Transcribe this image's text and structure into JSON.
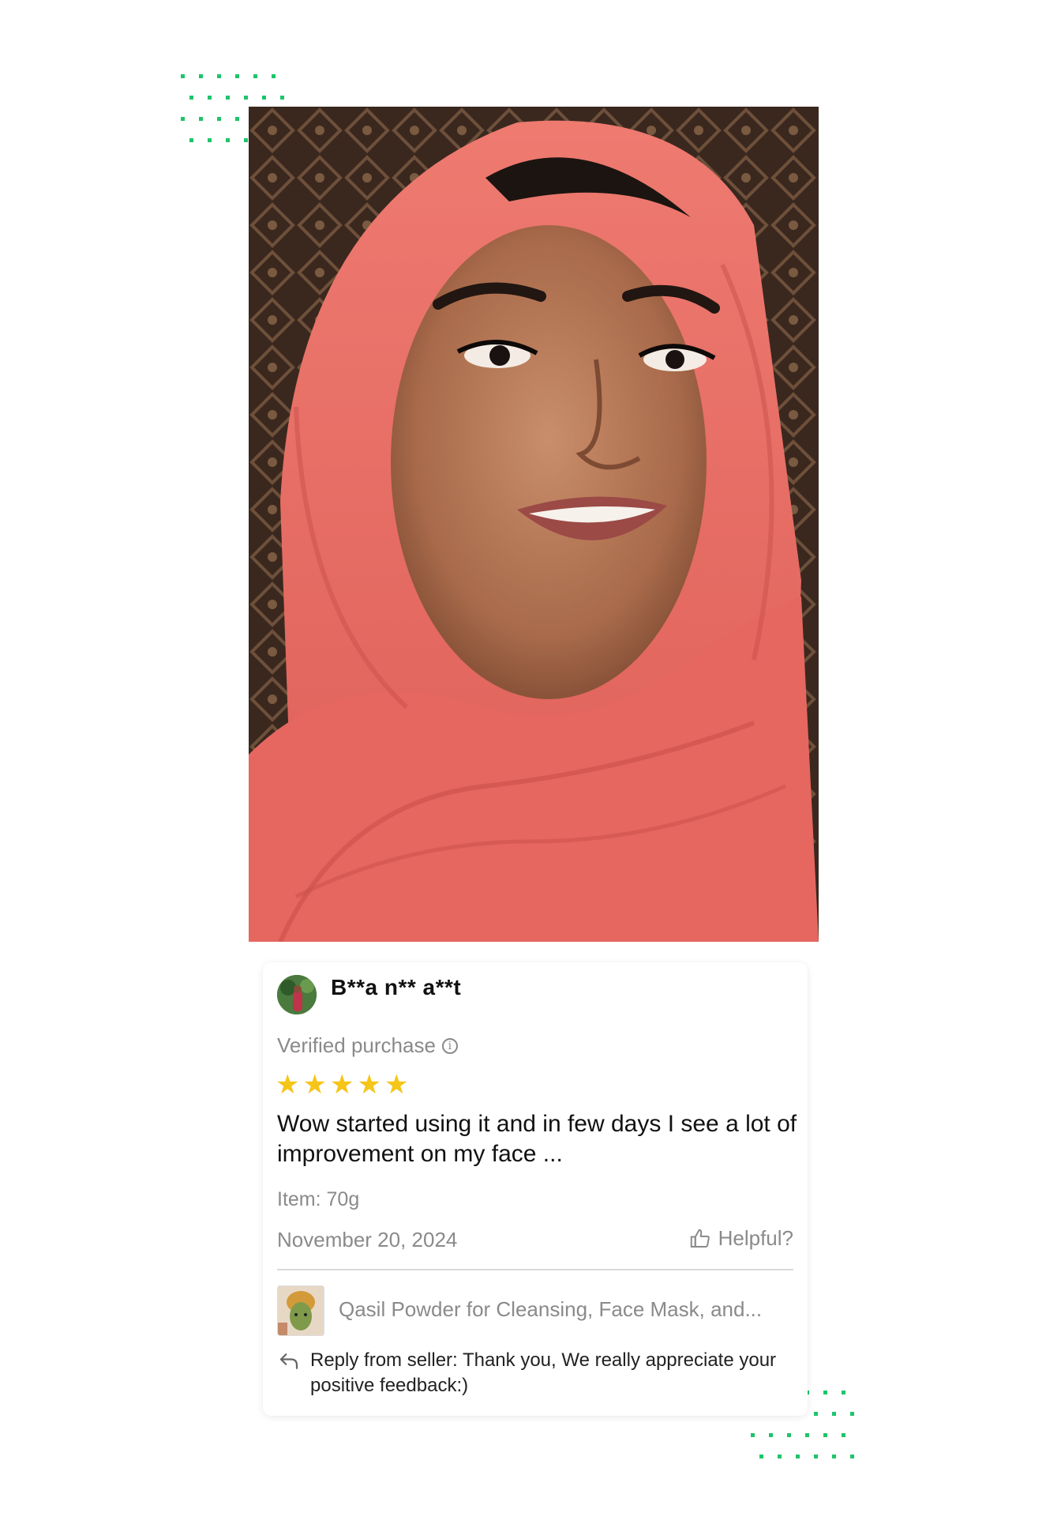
{
  "review": {
    "username": "B**a n** a**t",
    "verified_label": "Verified purchase",
    "rating": 5,
    "rating_max": 5,
    "text": "Wow started using it and in few days I see a lot of improvement on my face ...",
    "item": "Item: 70g",
    "date": "November 20, 2024",
    "helpful_label": "Helpful?"
  },
  "product": {
    "name": "Qasil Powder for Cleansing, Face Mask, and..."
  },
  "seller_reply": {
    "text": "Reply from seller: Thank you, We really appreciate your positive feedback:)"
  },
  "colors": {
    "accent_dots": "#1ec46a",
    "star": "#f5c518",
    "scarf": "#e9706a",
    "muted_text": "#8a8a8a"
  },
  "icons": [
    "info-icon",
    "star-icon",
    "thumbs-up-icon",
    "reply-arrow-icon"
  ]
}
